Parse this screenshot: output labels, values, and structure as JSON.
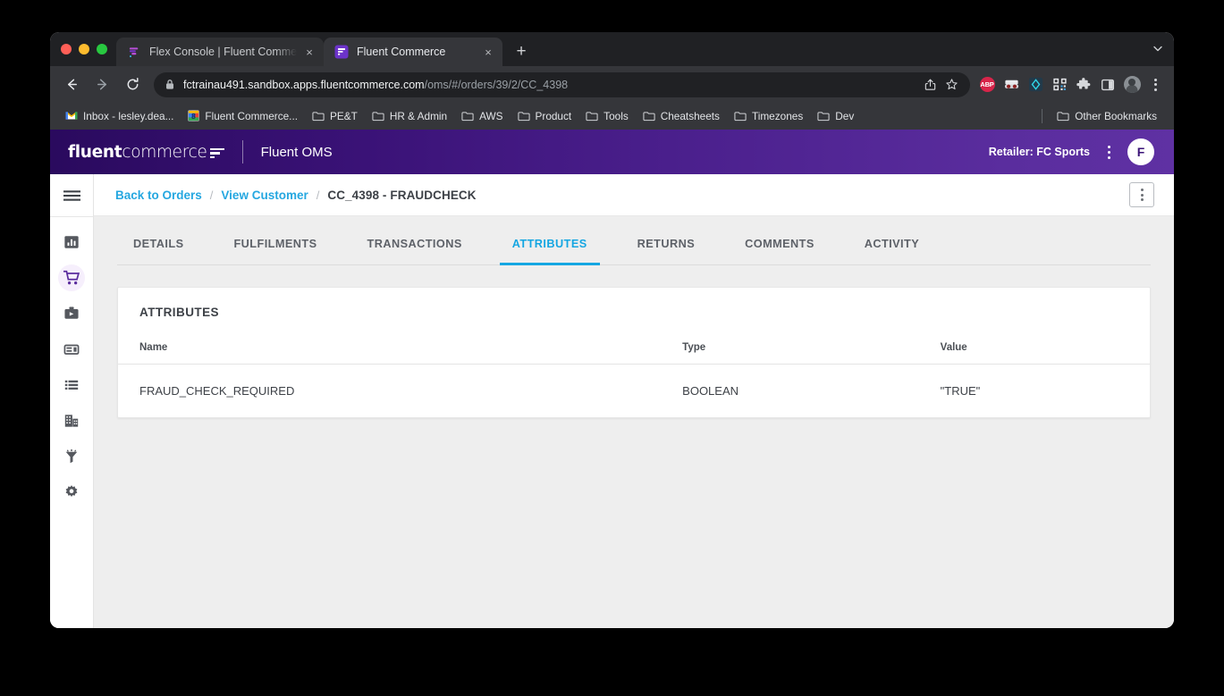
{
  "browser": {
    "tabs": [
      {
        "title": "Flex Console | Fluent Commerce",
        "favicon": "flex-console-icon",
        "active": false
      },
      {
        "title": "Fluent Commerce",
        "favicon": "fluent-commerce-icon",
        "active": true
      }
    ],
    "new_tab_label": "+",
    "tab_close_label": "×",
    "tab_list_chevron": "⌄",
    "nav": {
      "back_label": "←",
      "forward_label": "→",
      "reload_label": "⟳"
    },
    "omnibox": {
      "host": "fctrainau491.sandbox.apps.fluentcommerce.com",
      "path": "/oms/#/orders/39/2/CC_4398",
      "lock_icon": "lock-icon",
      "share_icon": "share-icon",
      "bookmark_icon": "star-icon"
    },
    "extensions": [
      {
        "name": "adblock-plus-icon",
        "label": "ABP"
      },
      {
        "name": "incognito-mask-icon",
        "label": ""
      },
      {
        "name": "password-manager-icon",
        "label": ""
      },
      {
        "name": "qr-code-icon",
        "label": ""
      },
      {
        "name": "puzzle-extensions-icon",
        "label": ""
      },
      {
        "name": "side-panel-icon",
        "label": ""
      },
      {
        "name": "profile-avatar-icon",
        "label": ""
      }
    ],
    "menu_icon": "chrome-menu-icon",
    "bookmarks": [
      {
        "label": "Inbox - lesley.dea...",
        "icon": "gmail-icon"
      },
      {
        "label": "Fluent Commerce...",
        "icon": "bookmark-site-icon"
      },
      {
        "label": "PE&T",
        "icon": "folder-icon"
      },
      {
        "label": "HR & Admin",
        "icon": "folder-icon"
      },
      {
        "label": "AWS",
        "icon": "folder-icon"
      },
      {
        "label": "Product",
        "icon": "folder-icon"
      },
      {
        "label": "Tools",
        "icon": "folder-icon"
      },
      {
        "label": "Cheatsheets",
        "icon": "folder-icon"
      },
      {
        "label": "Timezones",
        "icon": "folder-icon"
      },
      {
        "label": "Dev",
        "icon": "folder-icon"
      }
    ],
    "other_bookmarks": {
      "label": "Other Bookmarks",
      "icon": "folder-icon"
    }
  },
  "app": {
    "logo": {
      "bold_text": "fluent",
      "light_text": "commerce",
      "mark": "fluent-logo-mark"
    },
    "title": "Fluent OMS",
    "retailer": "Retailer: FC Sports",
    "avatar_initial": "F",
    "header_menu_icon": "kebab-menu-icon"
  },
  "sidebar": {
    "menu_toggle": "hamburger-icon",
    "items": [
      {
        "name": "dashboard",
        "icon": "bar-chart-icon",
        "active": false
      },
      {
        "name": "orders",
        "icon": "shopping-cart-icon",
        "active": true
      },
      {
        "name": "inventory",
        "icon": "toolbox-icon",
        "active": false
      },
      {
        "name": "cards",
        "icon": "card-layout-icon",
        "active": false
      },
      {
        "name": "lists",
        "icon": "list-icon",
        "active": false
      },
      {
        "name": "locations",
        "icon": "building-icon",
        "active": false
      },
      {
        "name": "rules",
        "icon": "funnel-icon",
        "active": false
      },
      {
        "name": "settings",
        "icon": "gear-icon",
        "active": false
      }
    ]
  },
  "breadcrumb": {
    "items": [
      {
        "label": "Back to Orders",
        "link": true
      },
      {
        "label": "View Customer",
        "link": true
      },
      {
        "label": "CC_4398 - FRAUDCHECK",
        "link": false
      }
    ],
    "separator": "/",
    "actions_icon": "kebab-menu-icon"
  },
  "tabs": [
    {
      "label": "DETAILS",
      "active": false
    },
    {
      "label": "FULFILMENTS",
      "active": false
    },
    {
      "label": "TRANSACTIONS",
      "active": false
    },
    {
      "label": "ATTRIBUTES",
      "active": true
    },
    {
      "label": "RETURNS",
      "active": false
    },
    {
      "label": "COMMENTS",
      "active": false
    },
    {
      "label": "ACTIVITY",
      "active": false
    }
  ],
  "attributes_card": {
    "title": "ATTRIBUTES",
    "columns": [
      "Name",
      "Type",
      "Value"
    ],
    "rows": [
      {
        "name": "FRAUD_CHECK_REQUIRED",
        "type": "BOOLEAN",
        "value": "\"TRUE\""
      }
    ]
  },
  "colors": {
    "brand_purple_dark": "#2a0a5e",
    "brand_purple_light": "#5f31a3",
    "accent_cyan": "#15a6e2",
    "link_blue": "#25a7e0",
    "page_bg": "#eeeeee"
  }
}
